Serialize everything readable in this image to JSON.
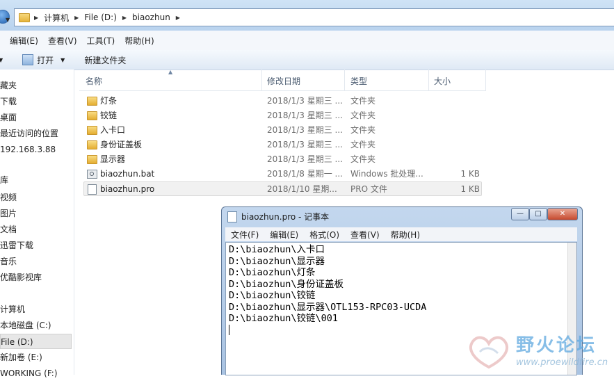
{
  "address": {
    "crumbs": [
      "计算机",
      "File (D:)",
      "biaozhun"
    ]
  },
  "menu": [
    "编辑(E)",
    "查看(V)",
    "工具(T)",
    "帮助(H)"
  ],
  "toolbar": {
    "open_label": "打开",
    "new_folder_label": "新建文件夹"
  },
  "nav": {
    "items": [
      "藏夹",
      "下载",
      "桌面",
      "最近访问的位置",
      "192.168.3.88",
      "库",
      "视频",
      "图片",
      "文档",
      "迅雷下载",
      "音乐",
      "优酷影视库",
      "计算机",
      "本地磁盘 (C:)",
      "File (D:)",
      "新加卷 (E:)",
      "WORKING (F:)"
    ],
    "selected": "File (D:)"
  },
  "columns": {
    "name": "名称",
    "date": "修改日期",
    "type": "类型",
    "size": "大小"
  },
  "files": [
    {
      "name": "灯条",
      "date": "2018/1/3 星期三 ...",
      "type": "文件夹",
      "size": "",
      "icon": "folder-icon"
    },
    {
      "name": "铰链",
      "date": "2018/1/3 星期三 ...",
      "type": "文件夹",
      "size": "",
      "icon": "folder-icon"
    },
    {
      "name": "入卡口",
      "date": "2018/1/3 星期三 ...",
      "type": "文件夹",
      "size": "",
      "icon": "folder-icon"
    },
    {
      "name": "身份证盖板",
      "date": "2018/1/3 星期三 ...",
      "type": "文件夹",
      "size": "",
      "icon": "folder-icon"
    },
    {
      "name": "显示器",
      "date": "2018/1/3 星期三 ...",
      "type": "文件夹",
      "size": "",
      "icon": "folder-icon"
    },
    {
      "name": "biaozhun.bat",
      "date": "2018/1/8 星期一 ...",
      "type": "Windows 批处理...",
      "size": "1 KB",
      "icon": "batch-file-icon"
    },
    {
      "name": "biaozhun.pro",
      "date": "2018/1/10 星期...",
      "type": "PRO 文件",
      "size": "1 KB",
      "icon": "text-file-icon"
    }
  ],
  "notepad": {
    "title": "biaozhun.pro - 记事本",
    "menu": [
      "文件(F)",
      "编辑(E)",
      "格式(O)",
      "查看(V)",
      "帮助(H)"
    ],
    "lines": [
      "D:\\biaozhun\\入卡口",
      "D:\\biaozhun\\显示器",
      "D:\\biaozhun\\灯条",
      "D:\\biaozhun\\身份证盖板",
      "D:\\biaozhun\\铰链",
      "D:\\biaozhun\\显示器\\OTL153-RPC03-UCDA",
      "D:\\biaozhun\\铰链\\001"
    ]
  },
  "watermark": {
    "title": "野火论坛",
    "url": "www.proewildfire.cn"
  }
}
